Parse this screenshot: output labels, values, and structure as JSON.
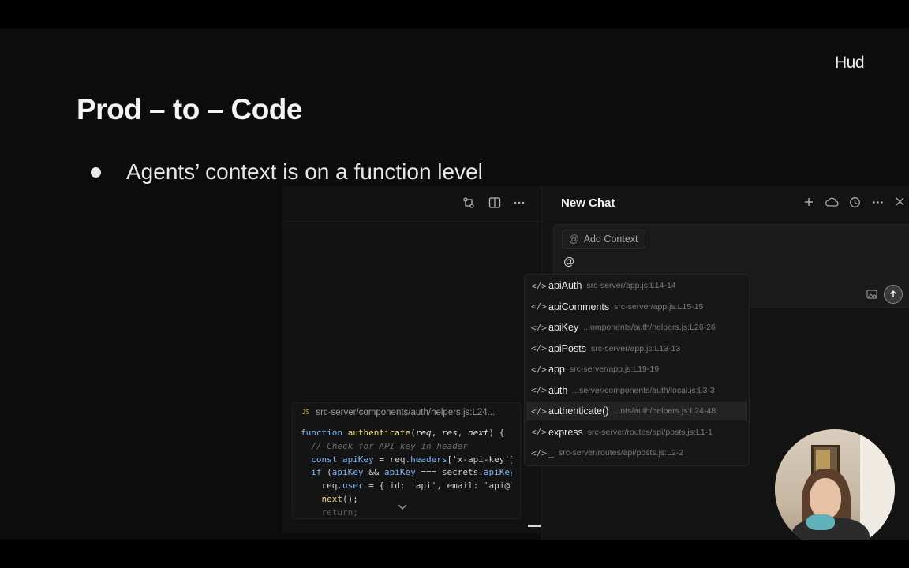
{
  "slide": {
    "logo": "Hud",
    "title": "Prod – to – Code",
    "bullet": "Agents’ context is on a function level"
  },
  "editor": {
    "toolbar_icons": [
      "git-compare-icon",
      "split-view-icon",
      "more-icon"
    ],
    "peek": {
      "file_badge": "JS",
      "path": "src-server/components/auth/helpers.js:L24..."
    }
  },
  "chat": {
    "title": "New Chat",
    "header_icons": [
      "plus-icon",
      "cloud-icon",
      "history-icon",
      "more-icon",
      "close-icon"
    ],
    "add_context_label": "Add Context",
    "input_value": "@",
    "mentions": [
      {
        "name": "apiAuth",
        "path": "src-server/app.js:L14-14",
        "selected": false
      },
      {
        "name": "apiComments",
        "path": "src-server/app.js:L15-15",
        "selected": false
      },
      {
        "name": "apiKey",
        "path": "...omponents/auth/helpers.js:L26-26",
        "selected": false
      },
      {
        "name": "apiPosts",
        "path": "src-server/app.js:L13-13",
        "selected": false
      },
      {
        "name": "app",
        "path": "src-server/app.js:L19-19",
        "selected": false
      },
      {
        "name": "auth",
        "path": "...server/components/auth/local.js:L3-3",
        "selected": false
      },
      {
        "name": "authenticate()",
        "path": "...nts/auth/helpers.js:L24-48",
        "selected": true
      },
      {
        "name": "express",
        "path": "src-server/routes/api/posts.js:L1-1",
        "selected": false
      },
      {
        "name": "_",
        "path": "src-server/routes/api/posts.js:L2-2",
        "selected": false
      }
    ]
  }
}
